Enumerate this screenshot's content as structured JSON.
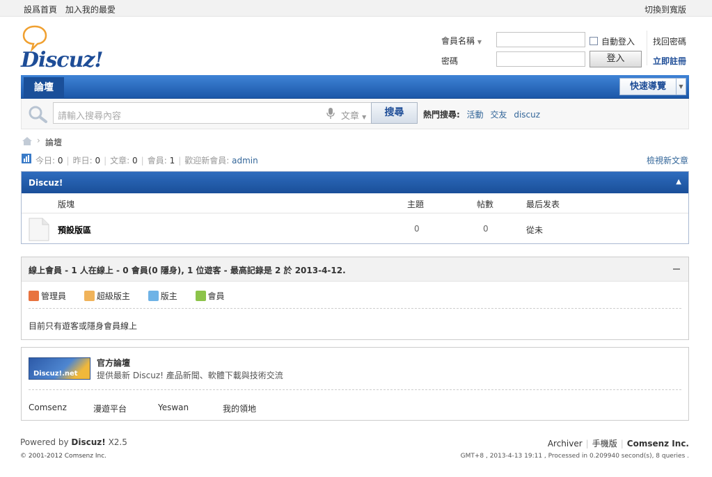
{
  "topbar": {
    "set_home": "設爲首頁",
    "add_fav": "加入我的最愛",
    "switch_width": "切換到寬版"
  },
  "logo": {
    "text": "Discuz!"
  },
  "login": {
    "username_label": "會員名稱",
    "password_label": "密碼",
    "auto_login": "自動登入",
    "login_button": "登入",
    "forgot": "找回密碼",
    "register": "立即註冊"
  },
  "nav": {
    "tab_forum": "論壇",
    "quick_nav": "快速導覽"
  },
  "search": {
    "placeholder": "請輸入搜尋內容",
    "type": "文章",
    "button": "搜尋",
    "hot_label": "熱門搜尋:",
    "hot": [
      "活動",
      "交友",
      "discuz"
    ]
  },
  "breadcrumb": {
    "current": "論壇"
  },
  "stats": {
    "today_label": "今日:",
    "today": "0",
    "yesterday_label": "昨日:",
    "yesterday": "0",
    "posts_label": "文章:",
    "posts": "0",
    "members_label": "會員:",
    "members": "1",
    "welcome_label": "歡迎新會員:",
    "newest": "admin",
    "view_new": "檢視新文章"
  },
  "forum": {
    "title": "Discuz!",
    "columns": {
      "board": "版塊",
      "threads": "主題",
      "posts": "帖數",
      "last": "最后发表"
    },
    "rows": [
      {
        "name": "預設版區",
        "threads": "0",
        "posts": "0",
        "last": "從未"
      }
    ]
  },
  "online": {
    "title": "線上會員 - 1 人在線上 - 0 會員(0 隱身), 1 位遊客 - 最高記錄是 2 於 2013-4-12.",
    "legend": [
      {
        "label": "管理員",
        "color": "#e8733f"
      },
      {
        "label": "超級版主",
        "color": "#f0b35a"
      },
      {
        "label": "版主",
        "color": "#6fb3e6"
      },
      {
        "label": "會員",
        "color": "#8cc34a"
      }
    ],
    "message": "目前只有遊客或隱身會員線上"
  },
  "links": {
    "badge_text": "Discuz!.net",
    "official_title": "官方論壇",
    "official_desc": "提供最新 Discuz! 產品新聞、軟體下載與技術交流",
    "items": [
      "Comsenz",
      "漫遊平台",
      "Yeswan",
      "我的領地"
    ]
  },
  "footer": {
    "powered_prefix": "Powered by",
    "powered_brand": "Discuz!",
    "version": "X2.5",
    "copyright": "© 2001-2012 Comsenz Inc.",
    "archiver": "Archiver",
    "mobile": "手機版",
    "company": "Comsenz Inc.",
    "stats_line": "GMT+8 , 2013-4-13 19:11 , Processed in 0.209940 second(s), 8 queries ."
  }
}
